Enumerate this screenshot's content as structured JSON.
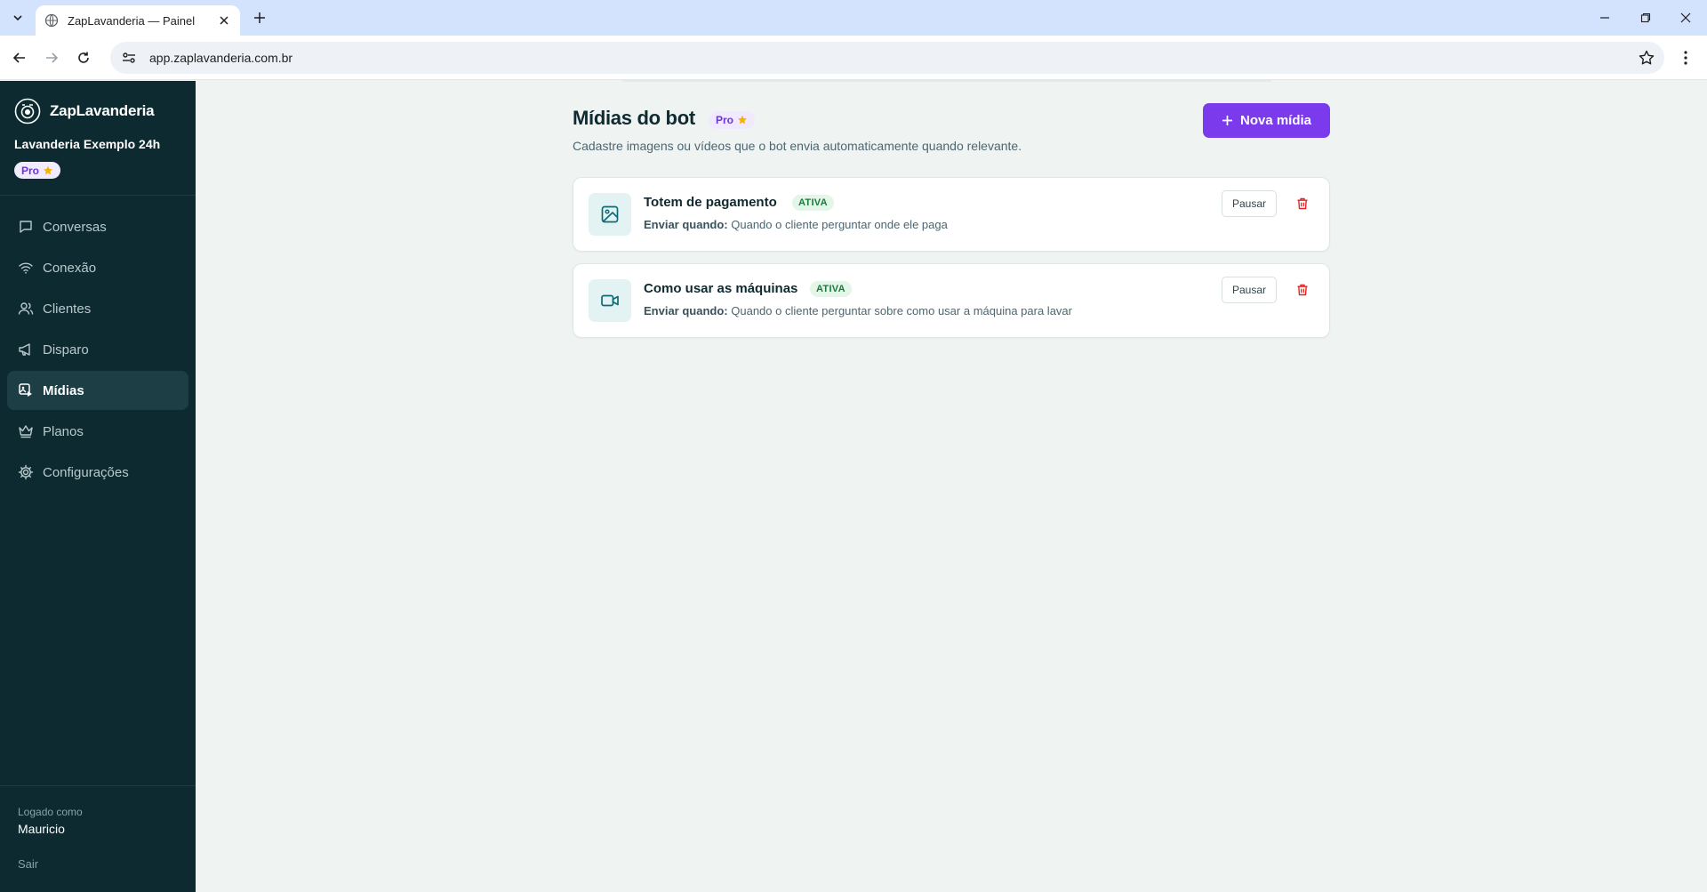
{
  "browser": {
    "tab_title": "ZapLavanderia — Painel",
    "url": "app.zaplavanderia.com.br"
  },
  "sidebar": {
    "brand": "ZapLavanderia",
    "tenant": "Lavanderia Exemplo 24h",
    "plan": "Pro",
    "items": [
      {
        "label": "Conversas",
        "icon": "chat-icon"
      },
      {
        "label": "Conexão",
        "icon": "wifi-icon"
      },
      {
        "label": "Clientes",
        "icon": "users-icon"
      },
      {
        "label": "Disparo",
        "icon": "megaphone-icon"
      },
      {
        "label": "Mídias",
        "icon": "media-icon",
        "active": true
      },
      {
        "label": "Planos",
        "icon": "crown-icon"
      },
      {
        "label": "Configurações",
        "icon": "gear-icon"
      }
    ],
    "logged_label": "Logado como",
    "user": "Mauricio",
    "logout": "Sair"
  },
  "main": {
    "title": "Mídias do bot",
    "plan_badge": "Pro",
    "subtitle": "Cadastre imagens ou vídeos que o bot envia automaticamente quando relevante.",
    "new_button": "Nova mídia",
    "media": [
      {
        "name": "Totem de pagamento",
        "status": "ATIVA",
        "when_label": "Enviar quando:",
        "when": "Quando o cliente perguntar onde ele paga",
        "pause_label": "Pausar",
        "icon": "image-icon"
      },
      {
        "name": "Como usar as máquinas",
        "status": "ATIVA",
        "when_label": "Enviar quando:",
        "when": "Quando o cliente perguntar sobre como usar a máquina para lavar",
        "pause_label": "Pausar",
        "icon": "video-icon"
      }
    ]
  },
  "colors": {
    "sidebar_bg": "#0d2a31",
    "accent": "#7c3aed",
    "status_active": "#1b7a3c",
    "delete": "#dc2626"
  }
}
